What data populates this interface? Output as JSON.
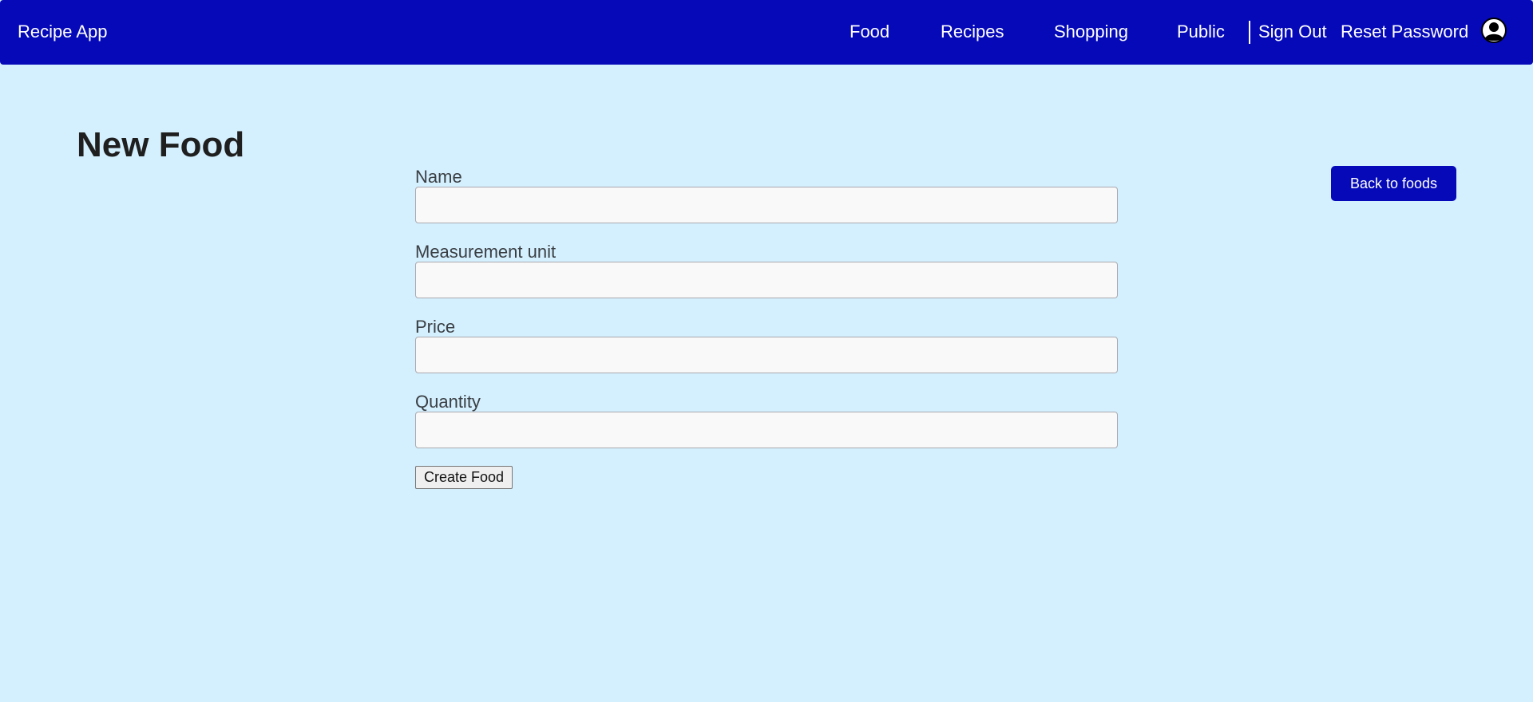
{
  "navbar": {
    "brand": "Recipe App",
    "links": {
      "food": "Food",
      "recipes": "Recipes",
      "shopping": "Shopping",
      "public": "Public",
      "sign_out": "Sign Out",
      "reset_password": "Reset Password"
    },
    "avatar_icon": "user-avatar-icon",
    "background_color": "#0509b8"
  },
  "page": {
    "title": "New Food",
    "background_color": "#d4effd"
  },
  "form": {
    "fields": [
      {
        "label": "Name",
        "value": "",
        "placeholder": ""
      },
      {
        "label": "Measurement unit",
        "value": "",
        "placeholder": ""
      },
      {
        "label": "Price",
        "value": "",
        "placeholder": ""
      },
      {
        "label": "Quantity",
        "value": "",
        "placeholder": ""
      }
    ],
    "submit_label": "Create Food"
  },
  "actions": {
    "back_label": "Back to foods",
    "accent_color": "#0509b8"
  }
}
